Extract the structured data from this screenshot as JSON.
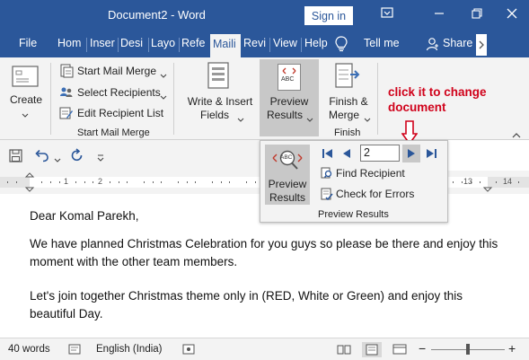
{
  "titlebar": {
    "title": "Document2  -  Word",
    "signin": "Sign in"
  },
  "tabs": [
    "File",
    "Hom",
    "Inser",
    "Desi",
    "Layo",
    "Refe",
    "Maili",
    "Revi",
    "View",
    "Help"
  ],
  "tellme": "Tell me",
  "share": "Share",
  "ribbon": {
    "create": "Create",
    "start_mail_merge": "Start Mail Merge",
    "select_recipients": "Select Recipients",
    "edit_recipient_list": "Edit Recipient List",
    "group_start_mail_merge": "Start Mail Merge",
    "write_insert_line1": "Write & Insert",
    "write_insert_line2": "Fields",
    "preview_line1": "Preview",
    "preview_line2": "Results",
    "finish_line1": "Finish &",
    "finish_line2": "Merge",
    "group_finish": "Finish",
    "preview_icon_text": "ABC"
  },
  "popup": {
    "preview_line1": "Preview",
    "preview_line2": "Results",
    "record_number": "2",
    "find_recipient": "Find Recipient",
    "check_errors": "Check for Errors",
    "group_label": "Preview Results",
    "icon_text": "ABC"
  },
  "annotation": {
    "line1": "click it to change",
    "line2": "document"
  },
  "ruler": {
    "marks": [
      "1",
      "2",
      "13",
      "14"
    ]
  },
  "document": {
    "greeting": "Dear Komal Parekh,",
    "p1_line1": "We have planned Christmas Celebration for you guys so please be there and enjoy this",
    "p1_line2": "moment with the other team members.",
    "p2_line1": "Let's join together Christmas theme only in (RED, White or Green) and enjoy this",
    "p2_line2": "beautiful Day."
  },
  "status": {
    "words": "40 words",
    "language": "English (India)",
    "zoom_minus": "−",
    "zoom_plus": "+"
  },
  "colors": {
    "word_blue": "#2b579a",
    "ribbon_bg": "#f3f3f3",
    "annotation_red": "#d0021b"
  }
}
